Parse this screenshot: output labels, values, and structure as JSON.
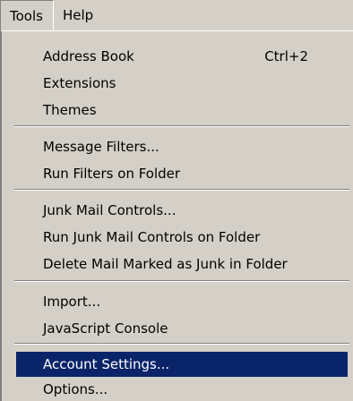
{
  "menubar": {
    "items": [
      {
        "label": "Tools"
      },
      {
        "label": "Help"
      }
    ]
  },
  "menu": {
    "items": [
      {
        "label": "Address Book",
        "shortcut": "Ctrl+2"
      },
      {
        "label": "Extensions"
      },
      {
        "label": "Themes"
      },
      {
        "label": "Message Filters..."
      },
      {
        "label": "Run Filters on Folder"
      },
      {
        "label": "Junk Mail Controls..."
      },
      {
        "label": "Run Junk Mail Controls on Folder"
      },
      {
        "label": "Delete Mail Marked as Junk in Folder"
      },
      {
        "label": "Import..."
      },
      {
        "label": "JavaScript Console"
      },
      {
        "label": "Account Settings...",
        "selected": true
      },
      {
        "label": "Options..."
      }
    ]
  },
  "colors": {
    "menu_background": "#d4d0c8",
    "selection_background": "#0a246a",
    "selection_text": "#ffffff"
  }
}
